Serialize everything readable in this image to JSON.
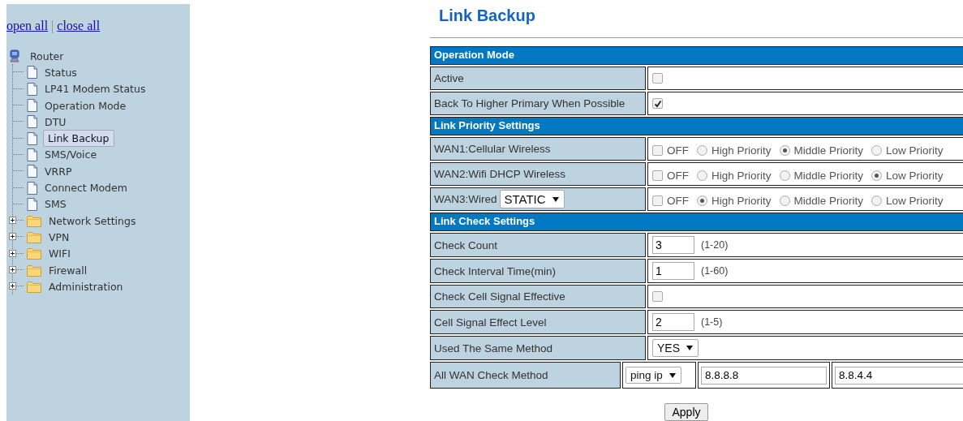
{
  "sidebar": {
    "links": [
      "open all",
      "close all"
    ],
    "link_separator": "|",
    "tree": {
      "label": "Router",
      "expanded": true,
      "children": [
        {
          "label": "Status",
          "kind": "page",
          "selected": false
        },
        {
          "label": "LP41 Modem Status",
          "kind": "page",
          "selected": false
        },
        {
          "label": "Operation Mode",
          "kind": "page",
          "selected": false
        },
        {
          "label": "DTU",
          "kind": "page",
          "selected": false
        },
        {
          "label": "Link Backup",
          "kind": "page",
          "selected": true
        },
        {
          "label": "SMS/Voice",
          "kind": "page",
          "selected": false
        },
        {
          "label": "VRRP",
          "kind": "page",
          "selected": false
        },
        {
          "label": "Connect Modem",
          "kind": "page",
          "selected": false
        },
        {
          "label": "SMS",
          "kind": "page",
          "selected": false
        },
        {
          "label": "Network Settings",
          "kind": "folder",
          "expanded": false,
          "selected": false
        },
        {
          "label": "VPN",
          "kind": "folder",
          "expanded": false,
          "selected": false
        },
        {
          "label": "WIFI",
          "kind": "folder",
          "expanded": false,
          "selected": false
        },
        {
          "label": "Firewall",
          "kind": "folder",
          "expanded": false,
          "selected": false
        },
        {
          "label": "Administration",
          "kind": "folder",
          "expanded": false,
          "selected": false
        }
      ]
    }
  },
  "page_title": "Link Backup",
  "sections": [
    {
      "title": "Operation Mode",
      "rows": [
        {
          "kind": "checkbox",
          "label": "Active",
          "checked": false
        },
        {
          "kind": "checkbox",
          "label": "Back To Higher Primary When Possible",
          "checked": true
        }
      ]
    },
    {
      "title": "Link Priority Settings",
      "rows": [
        {
          "kind": "priority",
          "label": "WAN1:Cellular Wireless",
          "off": {
            "label": "OFF",
            "checked": false
          },
          "options": [
            {
              "label": "High Priority",
              "selected": false
            },
            {
              "label": "Middle Priority",
              "selected": true
            },
            {
              "label": "Low Priority",
              "selected": false
            }
          ]
        },
        {
          "kind": "priority",
          "label": "WAN2:Wifi DHCP Wireless",
          "off": {
            "label": "OFF",
            "checked": false
          },
          "options": [
            {
              "label": "High Priority",
              "selected": false
            },
            {
              "label": "Middle Priority",
              "selected": false
            },
            {
              "label": "Low Priority",
              "selected": true
            }
          ]
        },
        {
          "kind": "priority",
          "label": "WAN3:Wired",
          "select": "STATIC",
          "off": {
            "label": "OFF",
            "checked": false
          },
          "options": [
            {
              "label": "High Priority",
              "selected": true
            },
            {
              "label": "Middle Priority",
              "selected": false
            },
            {
              "label": "Low Priority",
              "selected": false
            }
          ]
        }
      ]
    },
    {
      "title": "Link Check Settings",
      "rows": [
        {
          "kind": "number",
          "label": "Check Count",
          "value": "3",
          "range": "(1-20)"
        },
        {
          "kind": "number",
          "label": "Check Interval Time(min)",
          "value": "1",
          "range": "(1-60)"
        },
        {
          "kind": "checkbox",
          "label": "Check Cell Signal Effective",
          "checked": false
        },
        {
          "kind": "number",
          "label": "Cell Signal Effect Level",
          "value": "2",
          "range": "(1-5)"
        },
        {
          "kind": "select",
          "label": "Used The Same Method",
          "value": "YES"
        },
        {
          "kind": "method",
          "label": "All WAN Check Method",
          "method": "ping ip",
          "primary": "8.8.8.8",
          "secondary": "8.8.4.4"
        }
      ]
    }
  ],
  "apply_button": "Apply"
}
